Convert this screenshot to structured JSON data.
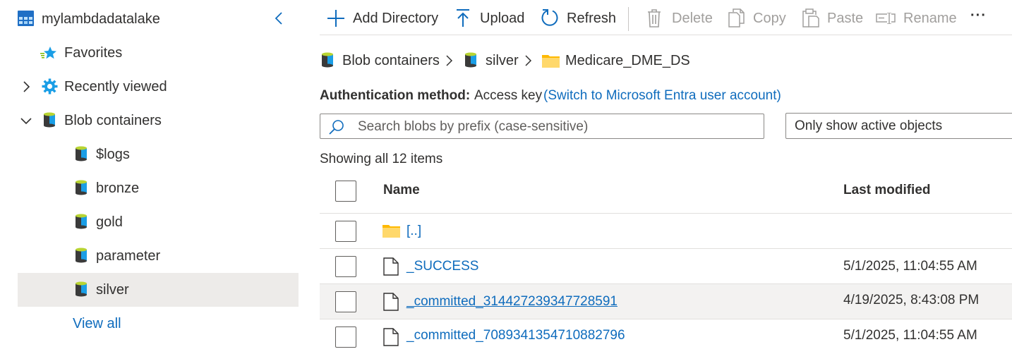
{
  "sidebar": {
    "account_name": "mylambdadatalake",
    "items": [
      {
        "label": "Favorites",
        "icon": "favorites-star-icon"
      },
      {
        "label": "Recently viewed",
        "icon": "recently-viewed-gear-icon"
      },
      {
        "label": "Blob containers",
        "icon": "blob-container-icon"
      }
    ],
    "containers": [
      {
        "label": "$logs"
      },
      {
        "label": "bronze"
      },
      {
        "label": "gold"
      },
      {
        "label": "parameter"
      },
      {
        "label": "silver",
        "selected": true
      }
    ],
    "view_all": "View all"
  },
  "toolbar": {
    "add_directory": "Add Directory",
    "upload": "Upload",
    "refresh": "Refresh",
    "delete": "Delete",
    "copy": "Copy",
    "paste": "Paste",
    "rename": "Rename",
    "more": "···"
  },
  "breadcrumb": {
    "items": [
      "Blob containers",
      "silver",
      "Medicare_DME_DS"
    ]
  },
  "auth": {
    "label": "Authentication method:",
    "value": "Access key",
    "switch_link": "(Switch to Microsoft Entra user account)"
  },
  "search": {
    "placeholder": "Search blobs by prefix (case-sensitive)",
    "filter_value": "Only show active objects"
  },
  "listing": {
    "count_text": "Showing all 12 items",
    "columns": {
      "name": "Name",
      "modified": "Last modified"
    },
    "rows": [
      {
        "name": "[..]",
        "modified": "",
        "type": "folder"
      },
      {
        "name": "_SUCCESS",
        "modified": "5/1/2025, 11:04:55 AM",
        "type": "file"
      },
      {
        "name": "_committed_314427239347728591",
        "modified": "4/19/2025, 8:43:08 PM",
        "type": "file"
      },
      {
        "name": "_committed_7089341354710882796",
        "modified": "5/1/2025, 11:04:55 AM",
        "type": "file"
      }
    ]
  },
  "colors": {
    "link": "#0f6cbd",
    "selected_bg": "#edebe9",
    "folder": "#ffb900"
  }
}
